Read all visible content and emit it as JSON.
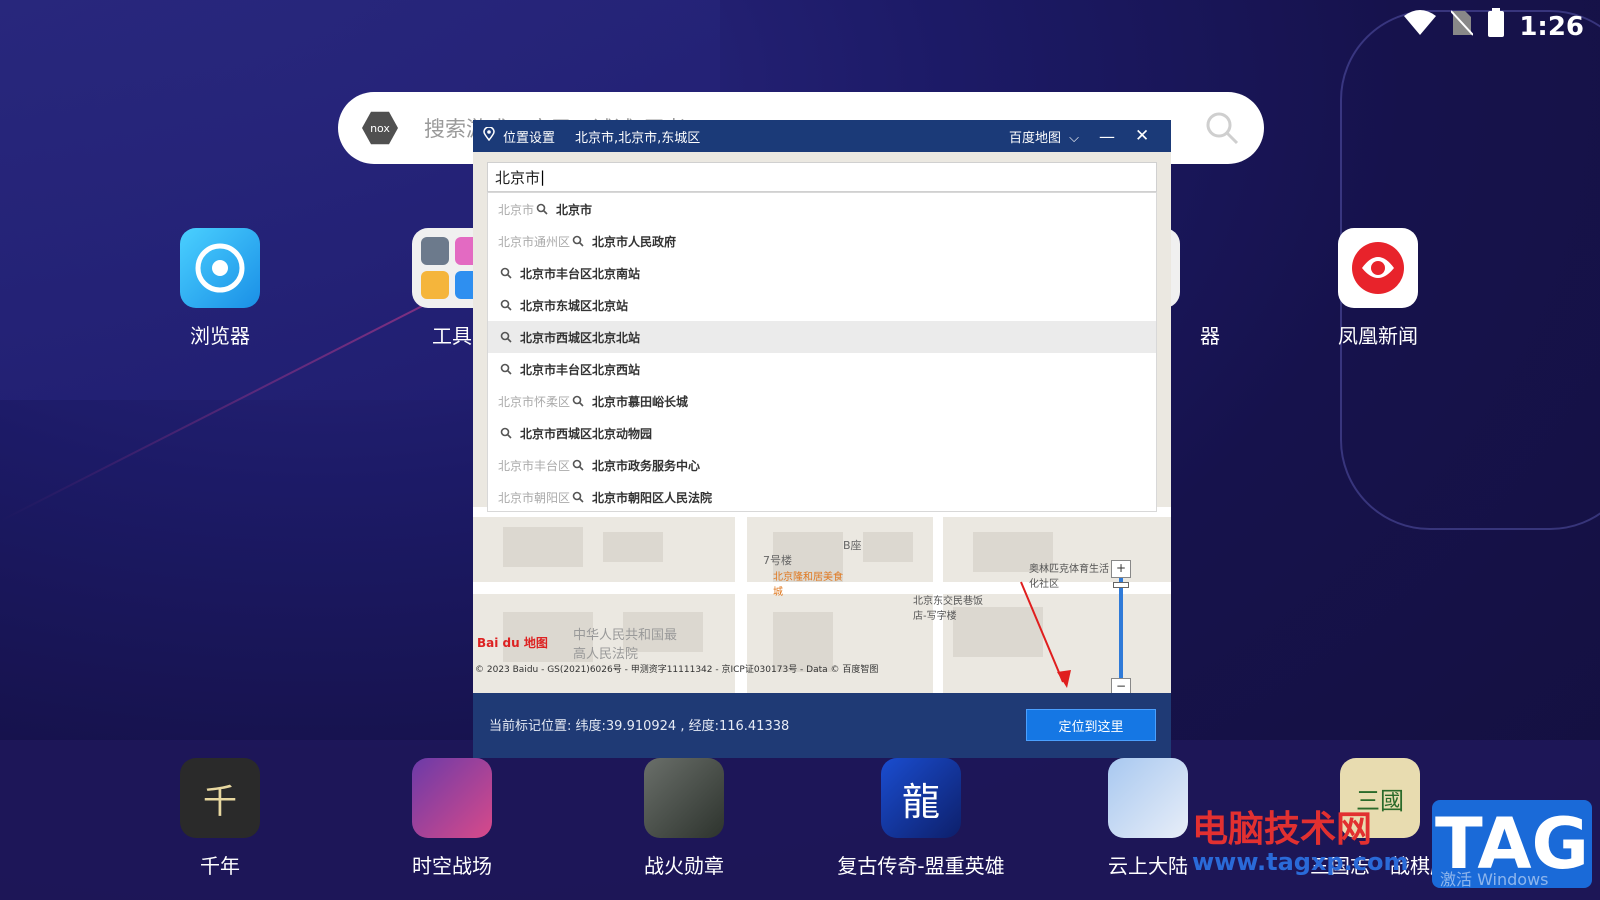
{
  "status_bar": {
    "time": "1:26",
    "icons": [
      "wifi-icon",
      "no-sim-icon",
      "battery-icon"
    ]
  },
  "search": {
    "placeholder": "搜索游戏、应用，试试\"王者\"...",
    "logo_text": "nox"
  },
  "home_apps": [
    {
      "label": "浏览器",
      "icon": "browser-icon"
    },
    {
      "label": "工具",
      "icon": "tools-folder-icon"
    },
    {
      "label": "...器",
      "icon": "app-icon"
    },
    {
      "label": "凤凰新闻",
      "icon": "ifeng-news-icon"
    }
  ],
  "home_apps_visible_labels": [
    "浏览器",
    "工具",
    "器",
    "凤凰新闻"
  ],
  "dock_apps": [
    {
      "label": "千年",
      "icon": "qiannian-icon"
    },
    {
      "label": "时空战场",
      "icon": "shikong-icon"
    },
    {
      "label": "战火勋章",
      "icon": "zhanhuo-icon"
    },
    {
      "label": "复古传奇-盟重英雄",
      "icon": "fugu-icon"
    },
    {
      "label": "云上大陆",
      "icon": "yunshang-icon"
    },
    {
      "label": "三国志・战棋版",
      "icon": "sanguo-icon"
    }
  ],
  "dialog": {
    "title": "位置设置",
    "current_location": "北京市,北京市,东城区",
    "map_provider": "百度地图",
    "search_value": "北京市",
    "columns": {
      "lat": "纬度",
      "lng": "经度"
    },
    "suggestions": [
      {
        "prefix": "北京市",
        "name": "北京市"
      },
      {
        "prefix": "北京市通州区",
        "name": "北京市人民政府"
      },
      {
        "prefix": "",
        "name": "北京市丰台区北京南站"
      },
      {
        "prefix": "",
        "name": "北京市东城区北京站"
      },
      {
        "prefix": "",
        "name": "北京市西城区北京北站",
        "selected": true
      },
      {
        "prefix": "",
        "name": "北京市丰台区北京西站"
      },
      {
        "prefix": "北京市怀柔区",
        "name": "北京市慕田峪长城"
      },
      {
        "prefix": "",
        "name": "北京市西城区北京动物园"
      },
      {
        "prefix": "北京市丰台区",
        "name": "北京市政务服务中心"
      },
      {
        "prefix": "北京市朝阳区",
        "name": "北京市朝阳区人民法院"
      }
    ],
    "map_labels": [
      "7号楼",
      "北京隆和居美食城",
      "B座",
      "北京东交民巷饭店-写字楼",
      "奥林匹克体育生活化社区",
      "中华人民共和国最高人民法院"
    ],
    "copyright": "© 2023 Baidu - GS(2021)6026号 - 甲测资字11111342 - 京ICP证030173号 - Data © 百度智图",
    "baidu_logo": "Bai du 地图",
    "current_marker_text": "当前标记位置:  纬度:39.910924 , 经度:116.41338",
    "locate_button": "定位到这里"
  },
  "watermark": {
    "site": "电脑技术网",
    "url": "www.tagxp.com",
    "tag": "TAG",
    "activate": "激活 Windows"
  },
  "colors": {
    "dialog_header": "#1b3a78",
    "locate_button": "#1577e4",
    "arrow": "#e01e1e"
  }
}
